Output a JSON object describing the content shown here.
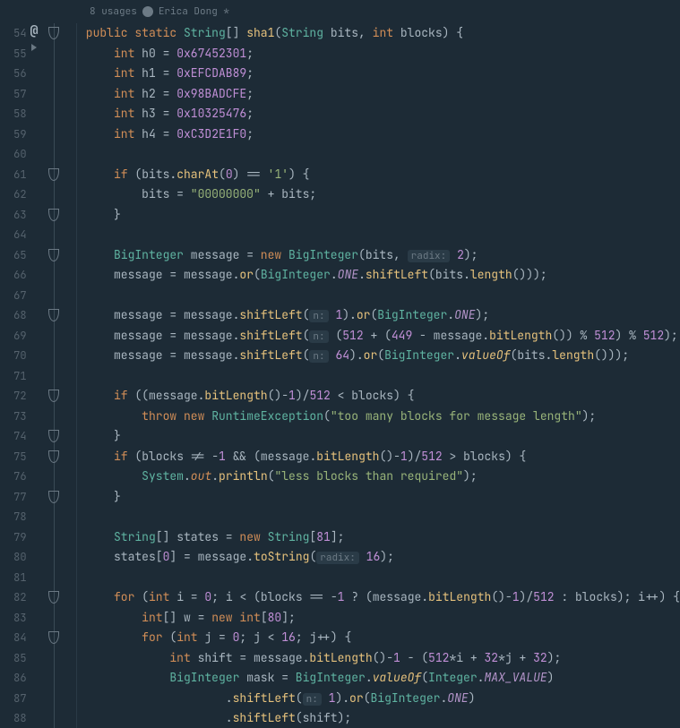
{
  "header": {
    "usages": "8 usages",
    "author": "Erica Dong *"
  },
  "lineStart": 54,
  "lineCount": 35,
  "markers": {
    "at": 54,
    "play": 54.6,
    "shields": [
      54,
      61,
      63,
      65,
      68,
      72,
      74,
      75,
      77,
      82,
      84
    ],
    "shieldsOpen": [
      63,
      74,
      77
    ]
  },
  "hints": {
    "radix": "radix:",
    "n": "n:"
  },
  "code": {
    "l54": {
      "i1": "public ",
      "i2": "static ",
      "t1": "String",
      "b1": "[] ",
      "fn": "sha1",
      "b2": "(",
      "t2": "String ",
      "a1": "bits",
      "c1": ", ",
      "t3": "int ",
      "a2": "blocks",
      "b3": ") {"
    },
    "l55": {
      "t": "int ",
      "v": "h0",
      "e": " = ",
      "n": "0x67452301",
      "s": ";"
    },
    "l56": {
      "t": "int ",
      "v": "h1",
      "e": " = ",
      "n": "0xEFCDAB89",
      "s": ";"
    },
    "l57": {
      "t": "int ",
      "v": "h2",
      "e": " = ",
      "n": "0x98BADCFE",
      "s": ";"
    },
    "l58": {
      "t": "int ",
      "v": "h3",
      "e": " = ",
      "n": "0x10325476",
      "s": ";"
    },
    "l59": {
      "t": "int ",
      "v": "h4",
      "e": " = ",
      "n": "0xC3D2E1F0",
      "s": ";"
    },
    "l61": {
      "k": "if ",
      "p1": "(",
      "v": "bits",
      "d": ".",
      "m": "charAt",
      "p2": "(",
      "n": "0",
      "p3": ")",
      "o": " == ",
      "s": "'1'",
      "p4": ") {"
    },
    "l62": {
      "v": "bits",
      "e": " = ",
      "s": "\"00000000\"",
      "o": " + ",
      "v2": "bits",
      "sc": ";"
    },
    "l63": {
      "b": "}"
    },
    "l65": {
      "t": "BigInteger ",
      "v": "message",
      "e": " = ",
      "k": "new ",
      "t2": "BigInteger",
      "p1": "(",
      "a1": "bits",
      "c": ", ",
      "n": "2",
      "p2": ");"
    },
    "l66": {
      "v": "message",
      "e": " = ",
      "v2": "message",
      "d": ".",
      "m": "or",
      "p1": "(",
      "t": "BigInteger",
      "d2": ".",
      "c": "ONE",
      "d3": ".",
      "m2": "shiftLeft",
      "p2": "(",
      "v3": "bits",
      "d4": ".",
      "m3": "length",
      "p3": "()));"
    },
    "l68": {
      "v": "message",
      "e": " = ",
      "v2": "message",
      "d": ".",
      "m": "shiftLeft",
      "p1": "( ",
      "n": "1",
      "p2": ").",
      "m2": "or",
      "p3": "(",
      "t": "BigInteger",
      "d2": ".",
      "c": "ONE",
      "p4": ");"
    },
    "l69": {
      "v": "message",
      "e": " = ",
      "v2": "message",
      "d": ".",
      "m": "shiftLeft",
      "p1": "( (",
      "n1": "512",
      "o1": " + (",
      "n2": "449",
      "o2": " - ",
      "v3": "message",
      "d2": ".",
      "m2": "bitLength",
      "p2": "())",
      "o3": " % ",
      "n3": "512",
      "p3": ")",
      "o4": " % ",
      "n4": "512",
      "p4": ");"
    },
    "l70": {
      "v": "message",
      "e": " = ",
      "v2": "message",
      "d": ".",
      "m": "shiftLeft",
      "p1": "( ",
      "n": "64",
      "p2": ").",
      "m2": "or",
      "p3": "(",
      "t": "BigInteger",
      "d2": ".",
      "m3": "valueOf",
      "p4": "(",
      "v3": "bits",
      "d3": ".",
      "m4": "length",
      "p5": "()));"
    },
    "l72": {
      "k": "if ",
      "p1": "((",
      "v": "message",
      "d": ".",
      "m": "bitLength",
      "p2": "()-",
      "n1": "1",
      "p3": ")/",
      "n2": "512",
      "o": " < ",
      "v2": "blocks",
      "p4": ") {"
    },
    "l73": {
      "k1": "throw ",
      "k2": "new ",
      "t": "RuntimeException",
      "p1": "(",
      "s": "\"too many blocks for message length\"",
      "p2": ");"
    },
    "l74": {
      "b": "}"
    },
    "l75": {
      "k": "if ",
      "p1": "(",
      "v": "blocks",
      "o1": " != -",
      "n1": "1",
      "o2": " && (",
      "v2": "message",
      "d": ".",
      "m": "bitLength",
      "p2": "()-",
      "n2": "1",
      "p3": ")/",
      "n3": "512",
      "o3": " > ",
      "v3": "blocks",
      "p4": ") {"
    },
    "l76": {
      "t": "System",
      "d": ".",
      "f1": "out",
      "d2": ".",
      "m": "println",
      "p1": "(",
      "s": "\"less blocks than required\"",
      "p2": ");"
    },
    "l77": {
      "b": "}"
    },
    "l79": {
      "t": "String",
      "b1": "[] ",
      "v": "states",
      "e": " = ",
      "k": "new ",
      "t2": "String",
      "b2": "[",
      "n": "81",
      "b3": "];"
    },
    "l80": {
      "v": "states",
      "b1": "[",
      "n1": "0",
      "b2": "] = ",
      "v2": "message",
      "d": ".",
      "m": "toString",
      "p1": "( ",
      "n2": "16",
      "p2": ");"
    },
    "l82": {
      "k": "for ",
      "p1": "(",
      "t": "int ",
      "v": "i",
      "e": " = ",
      "n1": "0",
      "s1": "; ",
      "v2": "i",
      "o1": " < (",
      "v3": "blocks",
      "o2": " == -",
      "n2": "1",
      "o3": " ? (",
      "v4": "message",
      "d": ".",
      "m": "bitLength",
      "p2": "()-",
      "n3": "1",
      "p3": ")/",
      "n4": "512",
      "o4": " : ",
      "v5": "blocks",
      "p4": "); ",
      "v6": "i",
      "o5": "++) {"
    },
    "l83": {
      "t": "int",
      "b1": "[] ",
      "v": "w",
      "e": " = ",
      "k": "new ",
      "t2": "int",
      "b2": "[",
      "n": "80",
      "b3": "];"
    },
    "l84": {
      "k": "for ",
      "p1": "(",
      "t": "int ",
      "v": "j",
      "e": " = ",
      "n1": "0",
      "s1": "; ",
      "v2": "j",
      "o1": " < ",
      "n2": "16",
      "s2": "; ",
      "v3": "j",
      "o2": "++) {"
    },
    "l85": {
      "t": "int ",
      "v": "shift",
      "e": " = ",
      "v2": "message",
      "d": ".",
      "m": "bitLength",
      "p1": "()-",
      "n1": "1",
      "o1": " - (",
      "n2": "512",
      "o2": "*",
      "v3": "i",
      "o3": " + ",
      "n3": "32",
      "o4": "*",
      "v4": "j",
      "o5": " + ",
      "n4": "32",
      "p2": ");"
    },
    "l86": {
      "t": "BigInteger ",
      "v": "mask",
      "e": " = ",
      "t2": "BigInteger",
      "d": ".",
      "m": "valueOf",
      "p1": "(",
      "t3": "Integer",
      "d2": ".",
      "c": "MAX_VALUE",
      "p2": ")"
    },
    "l87": {
      "d": ".",
      "m": "shiftLeft",
      "p1": "( ",
      "n": "1",
      "p2": ").",
      "m2": "or",
      "p3": "(",
      "t": "BigInteger",
      "d2": ".",
      "c": "ONE",
      "p4": ")"
    },
    "l88": {
      "d": ".",
      "m": "shiftLeft",
      "p1": "(",
      "v": "shift",
      "p2": ");"
    }
  }
}
